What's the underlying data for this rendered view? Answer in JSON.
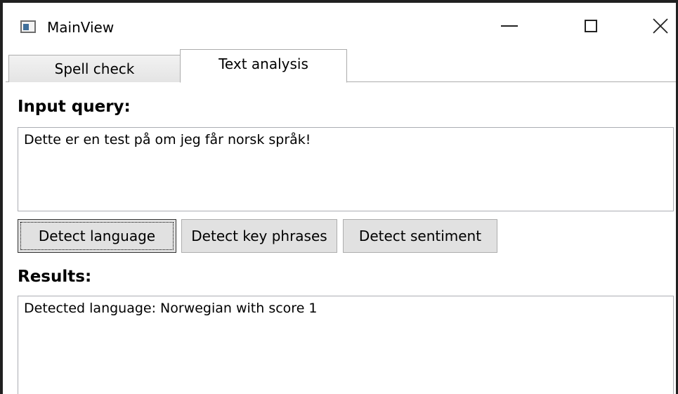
{
  "window": {
    "title": "MainView"
  },
  "tabs": [
    {
      "label": "Spell check",
      "selected": false
    },
    {
      "label": "Text analysis",
      "selected": true
    }
  ],
  "input": {
    "heading": "Input query:",
    "value": "Dette er en test på om jeg får norsk språk!"
  },
  "buttons": {
    "detect_language": "Detect language",
    "detect_key_phrases": "Detect key phrases",
    "detect_sentiment": "Detect sentiment"
  },
  "results": {
    "heading": "Results:",
    "value": "Detected language: Norwegian with score 1"
  },
  "icons": {
    "app": "app-window-icon",
    "minimize": "minimize-icon",
    "maximize": "maximize-icon",
    "close": "close-icon"
  }
}
